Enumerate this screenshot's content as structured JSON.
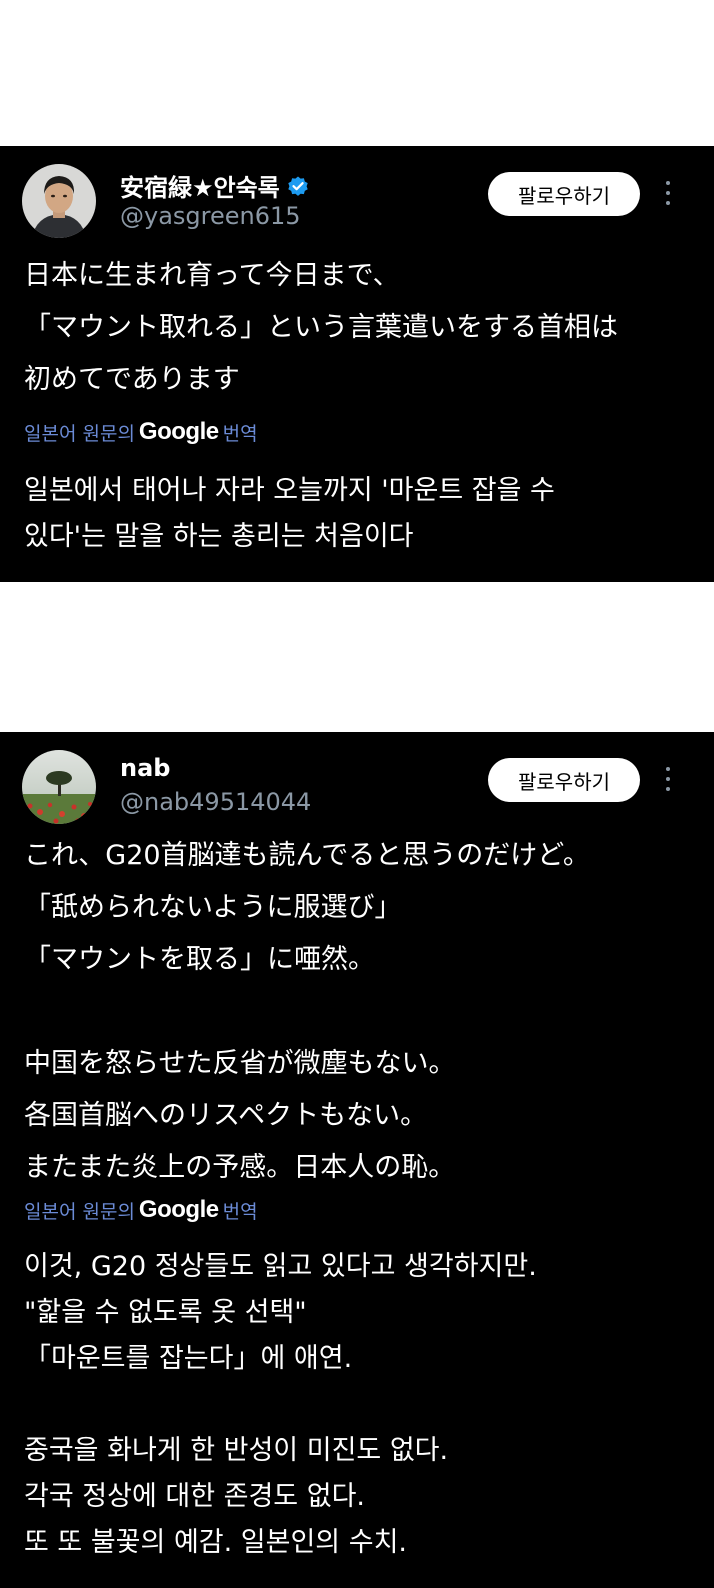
{
  "tweets": [
    {
      "display_name": "安宿緑★안숙록",
      "verified": true,
      "handle": "@yasgreen615",
      "follow_label": "팔로우하기",
      "text": "日本に生まれ育って今日まで、\n「マウント取れる」という言葉遣いをする首相は\n初めてであります",
      "translate_prefix": "일본어 원문의",
      "translate_brand": "Google",
      "translate_suffix": "번역",
      "translation": "일본에서 태어나 자라 오늘까지 '마운트 잡을 수\n있다'는 말을 하는 총리는 처음이다"
    },
    {
      "display_name": "nab",
      "verified": false,
      "handle": "@nab49514044",
      "follow_label": "팔로우하기",
      "text": "これ、G20首脳達も読んでると思うのだけど。\n「舐められないように服選び」\n「マウントを取る」に唖然。\n\n中国を怒らせた反省が微塵もない。\n各国首脳へのリスペクトもない。\nまたまた炎上の予感。日本人の恥。",
      "translate_prefix": "일본어 원문의",
      "translate_brand": "Google",
      "translate_suffix": "번역",
      "translation": "이것, G20 정상들도 읽고 있다고 생각하지만.\n\"핥을 수 없도록 옷 선택\"\n「마운트를 잡는다」에 애연.\n\n중국을 화나게 한 반성이 미진도 없다.\n각국 정상에 대한 존경도 없다.\n또 또 불꽃의 예감. 일본인의 수치."
    }
  ],
  "colors": {
    "background": "#000000",
    "handle": "#8b98a5",
    "translate_link": "#6b8bd6",
    "verified_badge": "#1d9bf0"
  }
}
